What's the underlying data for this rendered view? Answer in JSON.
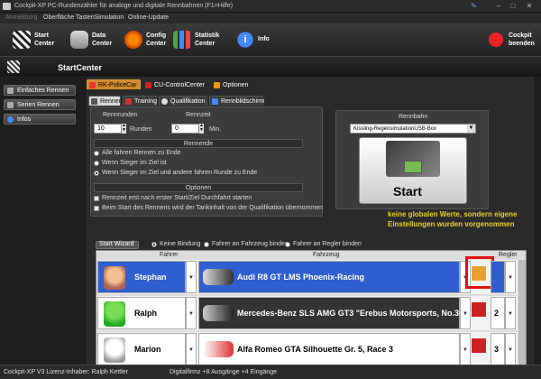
{
  "window": {
    "title": "Cockpit-XP PC-Rundenzähler für analoge und digitale Rennbahnen (F1=Hilfe)"
  },
  "menu": [
    "Anmeldung",
    "Oberfläche",
    "TastenSimulation",
    "Online-Update"
  ],
  "toolbar": {
    "start": "Start\nCenter",
    "data": "Data\nCenter",
    "config": "Config\nCenter",
    "statistic": "Statistik\nCenter",
    "info": "Info",
    "exit": "Cockpit\nbeenden"
  },
  "header": {
    "title": "StartCenter"
  },
  "sidebar": {
    "items": [
      "Einfaches Rennen",
      "Serien Rennen",
      "Infos"
    ]
  },
  "tabs_top": [
    "RK-PoliceCar",
    "CU-ControlCenter",
    "Optionen"
  ],
  "tabs_sub": [
    "Rennen",
    "Training",
    "Qualifikation",
    "Rennbildschirm"
  ],
  "race": {
    "rounds_label": "Rennrunden",
    "rounds_value": "10",
    "rounds_unit": "Runden",
    "time_label": "Rennzeit",
    "time_value": "0",
    "time_unit": "Min.",
    "end_header": "Rennende",
    "end_options": [
      "Alle fahren Rennen zu Ende",
      "Wenn Sieger im Ziel ist",
      "Wenn Sieger im Ziel und andere fahren Runde zu Ende"
    ],
    "options_header": "Optionen",
    "option_checks": [
      "Rennzeit erst nach erster Start/Ziel Durchfahrt starten",
      "Beim Start des Rennens wird der Tankinhalt von der Qualifikation übernommen"
    ]
  },
  "track": {
    "label": "Rennbahn",
    "value": "Kissling-RegensimulationUSB-Box"
  },
  "start_button": {
    "label": "Start"
  },
  "annotation": "keine globalen Werte, sondern eigene Einstellungen wurden vorgenommen",
  "binding": {
    "wizard": "Start Wizard",
    "options": [
      "Keine Bindung",
      "Fahrer an Fahrzeug binden",
      "Fahrer an Regler binden"
    ]
  },
  "table": {
    "headers": {
      "driver": "Fahrer",
      "car": "Fahrzeug",
      "controller": "Regler"
    },
    "rows": [
      {
        "driver": "Stephan",
        "car": "Audi R8 GT LMS Phoenix-Racing",
        "controller": "",
        "selected": true
      },
      {
        "driver": "Ralph",
        "car": "Mercedes-Benz SLS AMG GT3 \"Erebus Motorsports, No.36A\"",
        "controller": "2",
        "selected": false
      },
      {
        "driver": "Marion",
        "car": "Alfa Romeo GTA Silhouette Gr. 5, Race 3",
        "controller": "3",
        "selected": false
      }
    ]
  },
  "status": {
    "license": "Cockpit-XP V3 Lizenz-Inhaber: Ralph Kettler",
    "interface": "Digitalfirmz  +8 Ausgänge  +4 Eingänge"
  },
  "colors": {
    "accent": "#d08a2c",
    "selection": "#2f5fd0",
    "highlight_box": "#e01010",
    "annotation": "#e8d020"
  }
}
